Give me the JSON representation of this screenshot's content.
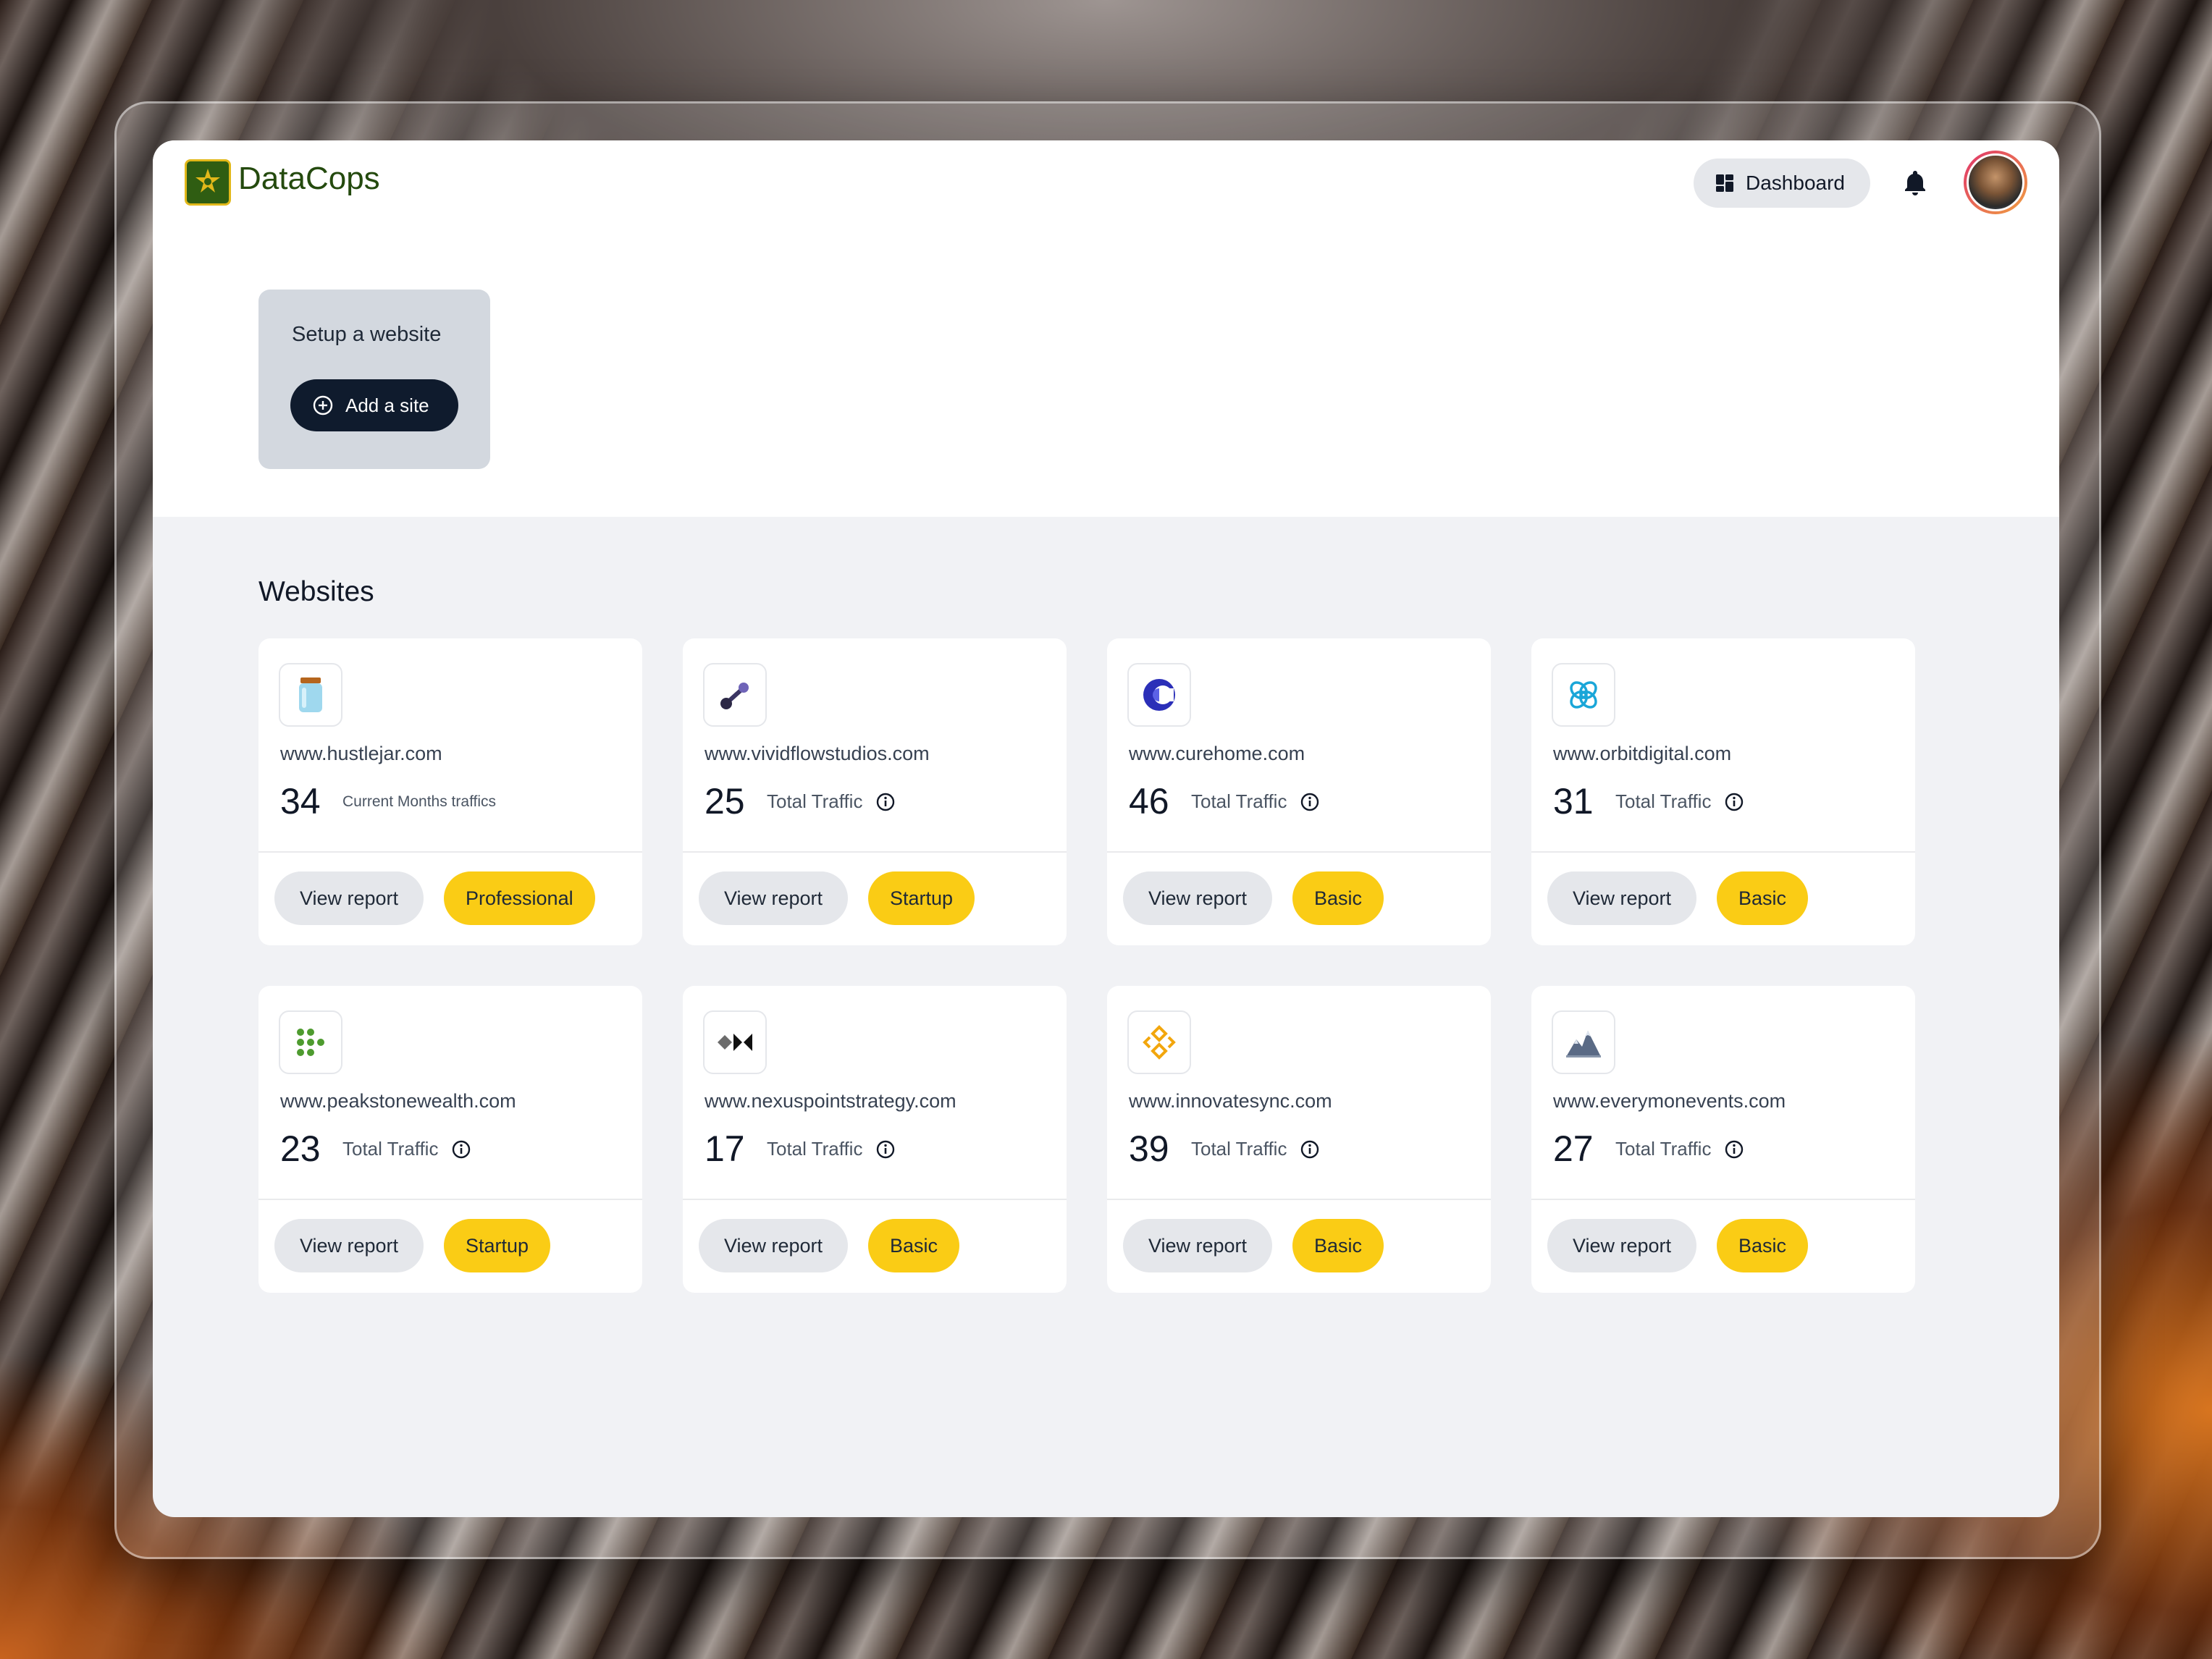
{
  "app": {
    "name": "DataCops"
  },
  "header": {
    "dashboard_label": "Dashboard"
  },
  "setup": {
    "title": "Setup a website",
    "add_label": "Add a site"
  },
  "websites": {
    "title": "Websites",
    "view_label": "View report",
    "cards": [
      {
        "domain": "www.hustlejar.com",
        "count": "34",
        "metric": "Current Months traffics",
        "plan": "Professional",
        "icon": "jar-icon"
      },
      {
        "domain": "www.vividflowstudios.com",
        "count": "25",
        "metric": "Total Traffic",
        "plan": "Startup",
        "icon": "flow-link-icon"
      },
      {
        "domain": "www.curehome.com",
        "count": "46",
        "metric": "Total Traffic",
        "plan": "Basic",
        "icon": "crescent-c-icon"
      },
      {
        "domain": "www.orbitdigital.com",
        "count": "31",
        "metric": "Total Traffic",
        "plan": "Basic",
        "icon": "orbit-knot-icon"
      },
      {
        "domain": "www.peakstonewealth.com",
        "count": "23",
        "metric": "Total Traffic",
        "plan": "Startup",
        "icon": "dot-grid-icon"
      },
      {
        "domain": "www.nexuspointstrategy.com",
        "count": "17",
        "metric": "Total Traffic",
        "plan": "Basic",
        "icon": "diamond-bowtie-icon"
      },
      {
        "domain": "www.innovatesync.com",
        "count": "39",
        "metric": "Total Traffic",
        "plan": "Basic",
        "icon": "diamond-arrows-icon"
      },
      {
        "domain": "www.everymonevents.com",
        "count": "27",
        "metric": "Total Traffic",
        "plan": "Basic",
        "icon": "mountain-icon"
      }
    ]
  },
  "colors": {
    "brand": "#244a0e",
    "badge": "#facc15",
    "primary_button": "#0f1b2d"
  }
}
